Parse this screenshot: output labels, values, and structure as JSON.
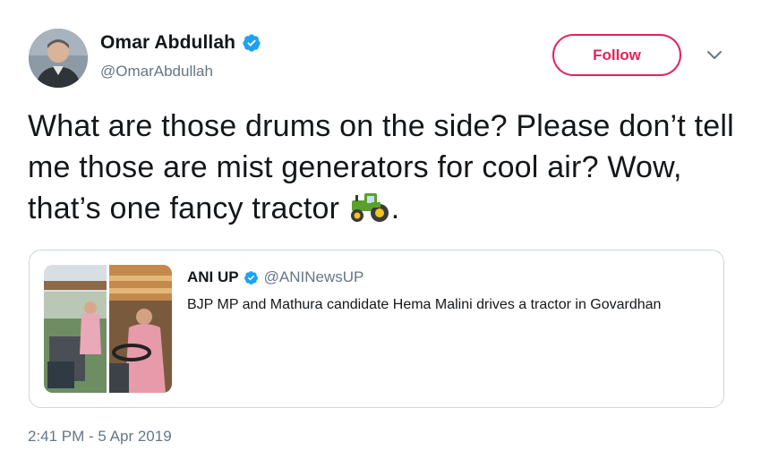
{
  "author": {
    "display_name": "Omar Abdullah",
    "handle": "@OmarAbdullah",
    "verified": true
  },
  "follow_button": {
    "label": "Follow"
  },
  "more_menu": {
    "icon": "chevron-down-icon"
  },
  "tweet": {
    "text_before_emoji": "What are those drums on the side? Please don’t tell me those are mist generators for cool air? Wow, that’s one fancy tractor ",
    "emoji": "tractor-emoji",
    "text_after_emoji": "."
  },
  "quoted_tweet": {
    "author_name": "ANI UP",
    "handle": "@ANINewsUP",
    "verified": true,
    "text": "BJP MP and Mathura candidate Hema Malini drives a tractor in Govardhan"
  },
  "timestamp": "2:41 PM - 5 Apr 2019",
  "colors": {
    "follow_accent": "#e0245e",
    "verified_blue": "#1da1f2",
    "secondary_text": "#657786",
    "primary_text": "#14171a",
    "border": "#ccd6dd"
  }
}
